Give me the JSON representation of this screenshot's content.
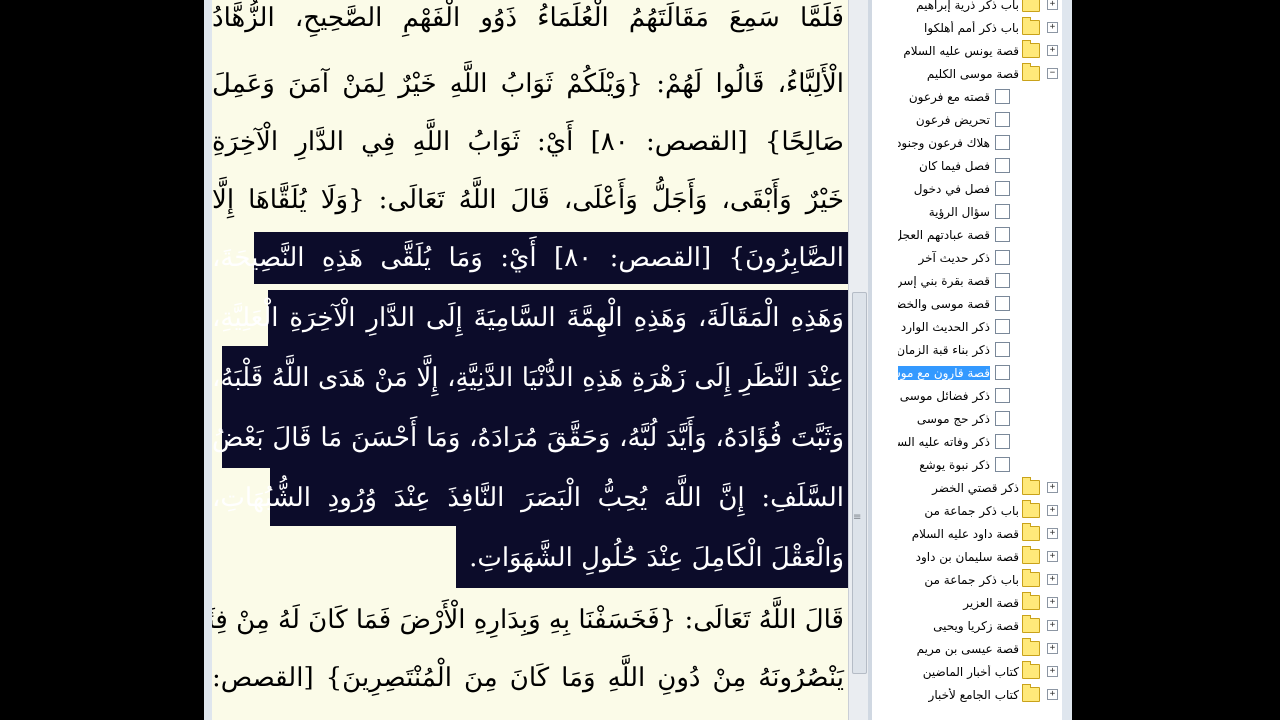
{
  "reader": {
    "lines": [
      "فَلَمَّا سَمِعَ مَقَالَتَهُمُ الْعُلَمَاءُ ذَوُو الْفَهْمِ الصَّحِيحِ، الزُّهَّادُ",
      "الْأَلِبَّاءُ، قَالُوا لَهُمْ: {وَيْلَكُمْ ثَوَابُ اللَّهِ خَيْرٌ لِمَنْ آمَنَ وَعَمِلَ",
      "صَالِحًا} [القصص: ٨٠] أَيْ: ثَوَابُ اللَّهِ فِي الدَّارِ الْآخِرَةِ",
      "خَيْرٌ وَأَبْقَى، وَأَجَلُّ وَأَعْلَى، قَالَ اللَّهُ تَعَالَى: {وَلَا يُلَقَّاهَا إِلَّا",
      "الصَّابِرُونَ} [القصص: ٨٠] أَيْ: وَمَا يُلَقَّى هَذِهِ النَّصِيحَةَ،",
      "وَهَذِهِ الْمَقَالَةَ، وَهَذِهِ الْهِمَّةَ السَّامِيَةَ إِلَى الدَّارِ الْآخِرَةِ الْعَلِيَّةِ،",
      "عِنْدَ النَّظَرِ إِلَى زَهْرَةِ هَذِهِ الدُّنْيَا الدَّنِيَّةِ، إِلَّا مَنْ هَدَى اللَّهُ قَلْبَهُ،",
      "وَثَبَّتَ فُؤَادَهُ، وَأَيَّدَ لُبَّهُ، وَحَقَّقَ مُرَادَهُ، وَمَا أَحْسَنَ مَا قَالَ بَعْضُ",
      "السَّلَفِ: إِنَّ اللَّهَ يُحِبُّ الْبَصَرَ النَّافِذَ عِنْدَ وُرُودِ الشُّبُهَاتِ،",
      "وَالْعَقْلَ الْكَامِلَ عِنْدَ حُلُولِ الشَّهَوَاتِ.",
      "قَالَ اللَّهُ تَعَالَى: {فَخَسَفْنَا بِهِ وَبِدَارِهِ الْأَرْضَ فَمَا كَانَ لَهُ مِنْ فِئَةٍ",
      "يَنْصُرُونَهُ مِنْ دُونِ اللَّهِ وَمَا كَانَ مِنَ الْمُنْتَصِرِينَ} [القصص:"
    ]
  },
  "tree": {
    "items": [
      {
        "label": "باب ذكر ذرية إبراهيم",
        "type": "folder",
        "expander": "+"
      },
      {
        "label": "باب ذكر أمم أهلكوا",
        "type": "folder",
        "expander": "+"
      },
      {
        "label": "قصة يونس عليه السلام",
        "type": "folder",
        "expander": "+"
      },
      {
        "label": "قصة موسى الكليم",
        "type": "folder",
        "expander": "−"
      },
      {
        "label": "قصته مع فرعون",
        "type": "check"
      },
      {
        "label": "تحريض فرعون",
        "type": "check"
      },
      {
        "label": "هلاك فرعون وجنوده",
        "type": "check"
      },
      {
        "label": "فصل فيما كان",
        "type": "check"
      },
      {
        "label": "فصل في دخول",
        "type": "check"
      },
      {
        "label": "سؤال الرؤية",
        "type": "check"
      },
      {
        "label": "قصة عبادتهم العجل",
        "type": "check"
      },
      {
        "label": "ذكر حديث آخر",
        "type": "check"
      },
      {
        "label": "قصة بقرة بني إسرائيل",
        "type": "check"
      },
      {
        "label": "قصة موسى والخضر",
        "type": "check"
      },
      {
        "label": "ذكر الحديث الوارد",
        "type": "check"
      },
      {
        "label": "ذكر بناء قبة الزمان",
        "type": "check"
      },
      {
        "label": "قصة قارون مع موسى",
        "type": "check",
        "selected": true
      },
      {
        "label": "ذكر فضائل موسى",
        "type": "check"
      },
      {
        "label": "ذكر حج موسى",
        "type": "check"
      },
      {
        "label": "ذكر وفاته عليه السلام",
        "type": "check"
      },
      {
        "label": "ذكر نبوة يوشع",
        "type": "check"
      },
      {
        "label": "ذكر قصتي الخضر",
        "type": "folder",
        "expander": "+"
      },
      {
        "label": "باب ذكر جماعة من",
        "type": "folder",
        "expander": "+"
      },
      {
        "label": "قصة داود عليه السلام",
        "type": "folder",
        "expander": "+"
      },
      {
        "label": "قصة سليمان بن داود",
        "type": "folder",
        "expander": "+"
      },
      {
        "label": "باب ذكر جماعة من",
        "type": "folder",
        "expander": "+"
      },
      {
        "label": "قصة العزير",
        "type": "folder",
        "expander": "+"
      },
      {
        "label": "قصة زكريا ويحيى",
        "type": "folder",
        "expander": "+"
      },
      {
        "label": "قصة عيسى بن مريم",
        "type": "folder",
        "expander": "+"
      },
      {
        "label": "كتاب أخبار الماضين",
        "type": "folder",
        "expander": "+"
      },
      {
        "label": "كتاب الجامع لأخبار",
        "type": "folder",
        "expander": "+"
      }
    ]
  }
}
